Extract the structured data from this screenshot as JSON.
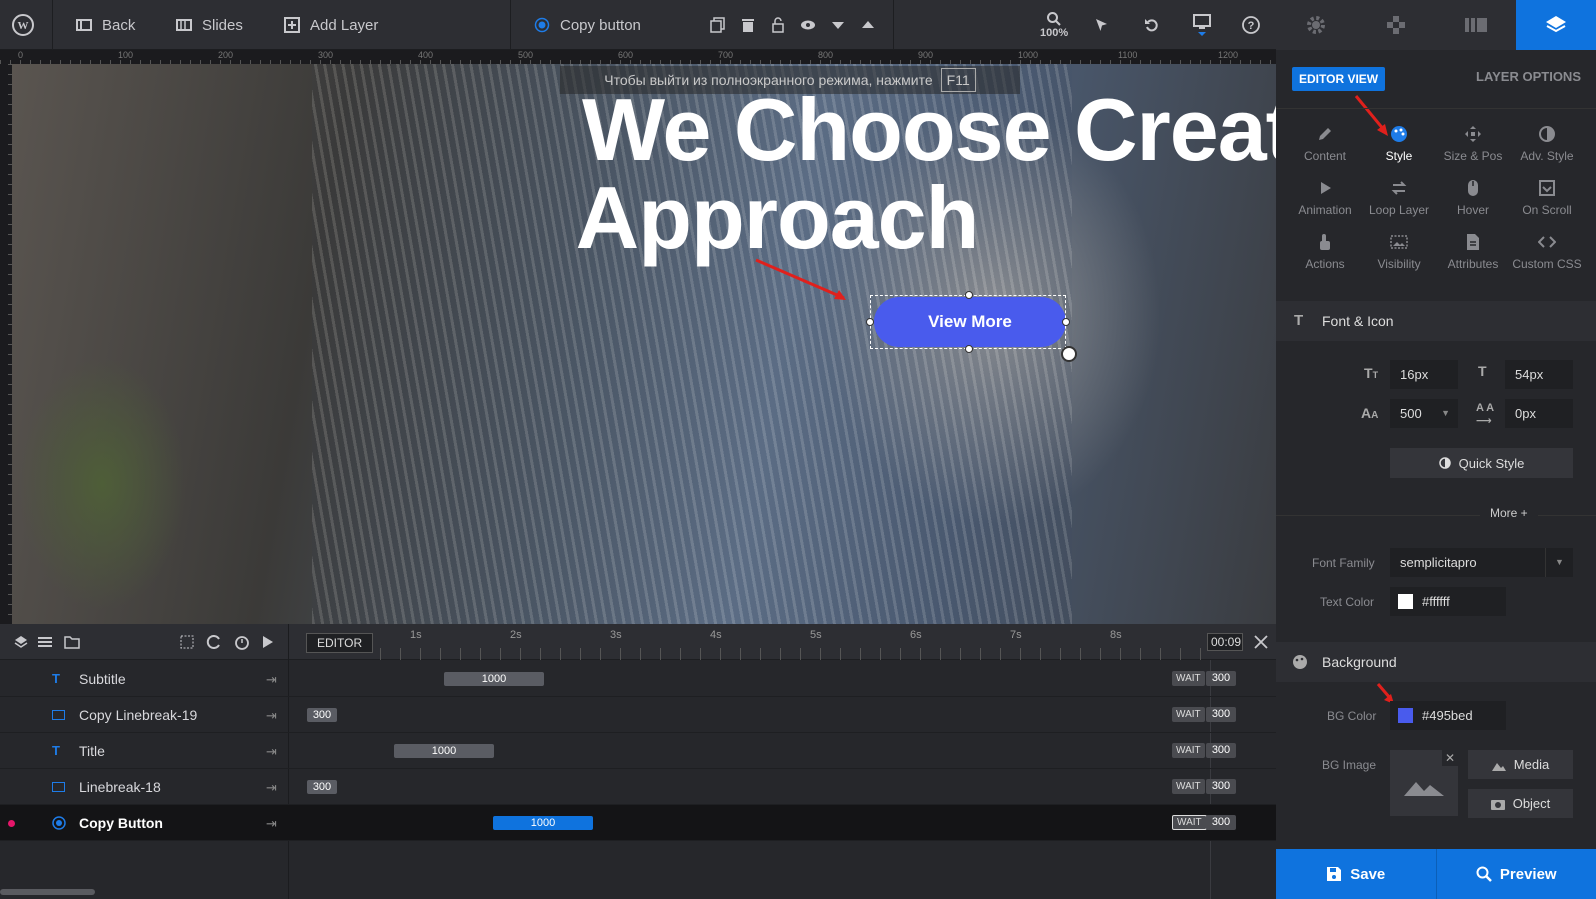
{
  "toolbar": {
    "back": "Back",
    "slides": "Slides",
    "add_layer": "Add Layer",
    "current_layer": "Copy button",
    "zoom": "100%"
  },
  "ruler": {
    "marks": [
      "0",
      "100",
      "200",
      "300",
      "400",
      "500",
      "600",
      "700",
      "800",
      "900",
      "1000",
      "1100",
      "1200"
    ]
  },
  "canvas": {
    "notice_text": "Чтобы выйти из полноэкранного режима, нажмите",
    "notice_key": "F11",
    "headline_line1": "We Choose Creative",
    "headline_line2": "Approach",
    "button_label": "View More"
  },
  "timeline": {
    "editor_label": "EDITOR",
    "time_display": "00:09",
    "ticks": [
      "1s",
      "2s",
      "3s",
      "4s",
      "5s",
      "6s",
      "7s",
      "8s"
    ],
    "rows": [
      {
        "name": "Subtitle",
        "type": "text",
        "bar": "1000",
        "wait": "WAIT",
        "wait_value": "300"
      },
      {
        "name": "Copy Linebreak-19",
        "type": "shape",
        "bar": "300",
        "wait": "WAIT",
        "wait_value": "300"
      },
      {
        "name": "Title",
        "type": "text",
        "bar": "1000",
        "wait": "WAIT",
        "wait_value": "300"
      },
      {
        "name": "Linebreak-18",
        "type": "shape",
        "bar": "300",
        "wait": "WAIT",
        "wait_value": "300"
      },
      {
        "name": "Copy Button",
        "type": "button",
        "bar": "1000",
        "wait": "WAIT",
        "wait_value": "300"
      }
    ]
  },
  "panel": {
    "editor_view": "EDITOR VIEW",
    "layer_options": "LAYER OPTIONS",
    "options": [
      "Content",
      "Style",
      "Size & Pos",
      "Adv. Style",
      "Animation",
      "Loop Layer",
      "Hover",
      "On Scroll",
      "Actions",
      "Visibility",
      "Attributes",
      "Custom CSS"
    ],
    "font_section": "Font & Icon",
    "font_size": "16px",
    "line_height": "54px",
    "font_weight": "500",
    "letter_spacing": "0px",
    "quick_style": "Quick Style",
    "more": "More",
    "font_family_label": "Font Family",
    "font_family": "semplicitapro",
    "text_color_label": "Text Color",
    "text_color": "#ffffff",
    "bg_section": "Background",
    "bg_color_label": "BG Color",
    "bg_color": "#495bed",
    "bg_image_label": "BG Image",
    "media": "Media",
    "object": "Object"
  },
  "footer": {
    "save": "Save",
    "preview": "Preview"
  },
  "colors": {
    "accent": "#0f73de",
    "button": "#495bed"
  }
}
